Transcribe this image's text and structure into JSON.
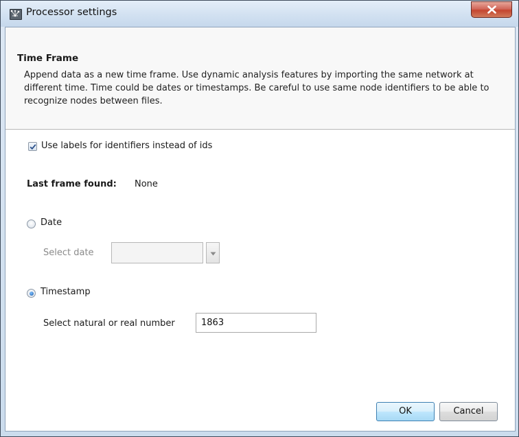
{
  "window": {
    "title": "Processor settings"
  },
  "header": {
    "section_title": "Time Frame",
    "description": "Append data as a new time frame. Use dynamic analysis features by importing the same network at different time. Time could be dates or timestamps. Be careful to use same node identifiers to be able to recognize nodes between files."
  },
  "options": {
    "use_labels_label": "Use labels for identifiers instead of ids",
    "use_labels_checked": true,
    "last_frame_label": "Last frame found:",
    "last_frame_value": "None",
    "date_radio_label": "Date",
    "select_date_label": "Select date",
    "timestamp_radio_label": "Timestamp",
    "select_number_label": "Select natural or real number",
    "number_value": "1863",
    "selected_mode": "Timestamp"
  },
  "buttons": {
    "ok": "OK",
    "cancel": "Cancel"
  },
  "icons": {
    "app": "graph-app-icon",
    "close": "close-icon",
    "checkmark": "checkmark-icon",
    "dropdown": "chevron-down-icon"
  },
  "colors": {
    "title_gradient": "#d2e1f1",
    "close_red": "#c4462f",
    "header_bg": "#f8f8f8",
    "default_button": "#bee6fd"
  }
}
